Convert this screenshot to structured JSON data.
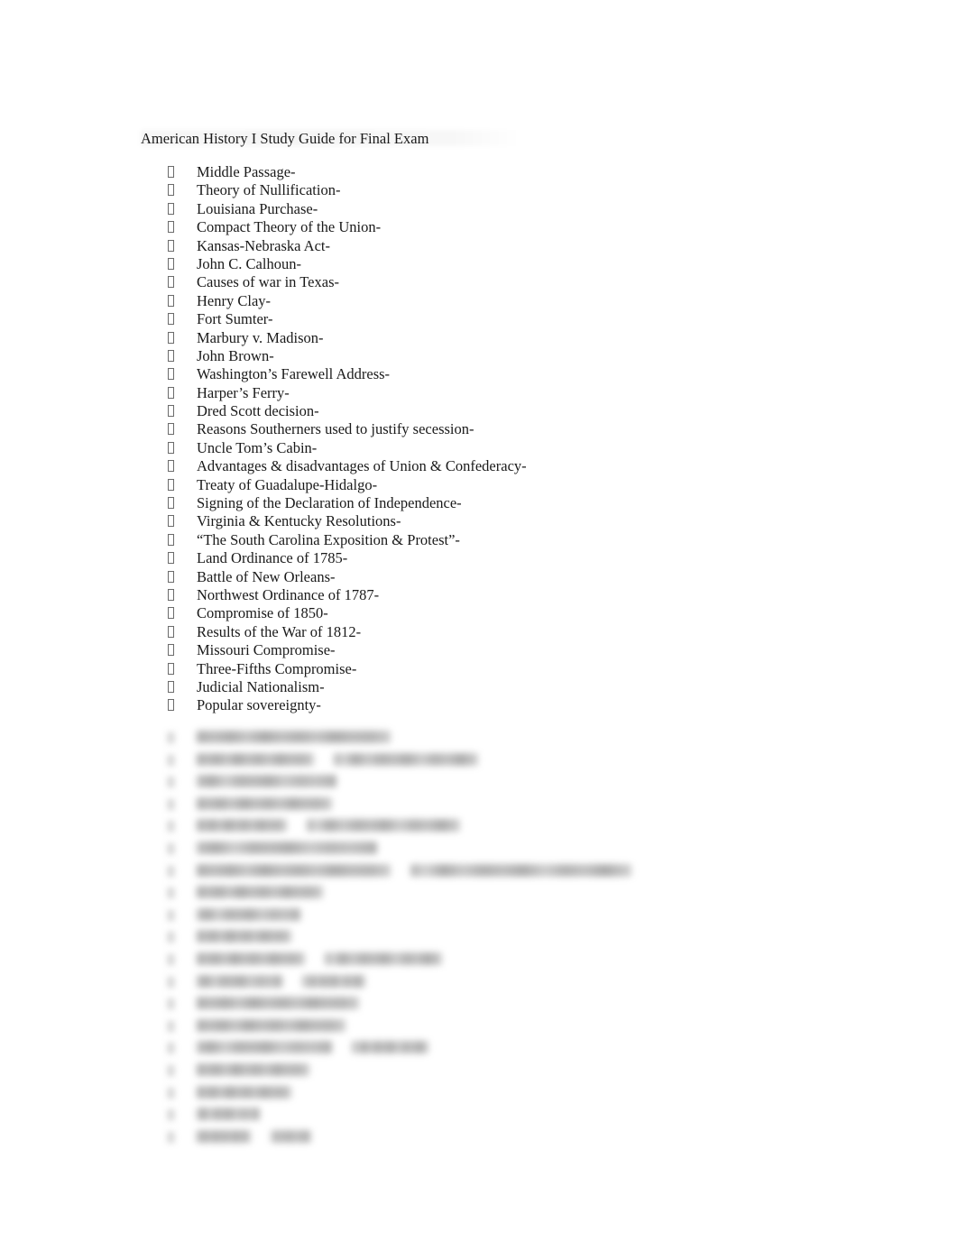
{
  "document": {
    "title": "American History I Study Guide for Final Exam",
    "title_highlight_color": "#eeeeee",
    "background_color": "#ffffff",
    "text_color": "#1a1a1a",
    "bullet_glyph": "missing-glyph-box"
  },
  "study_items": [
    {
      "text": "Middle Passage-"
    },
    {
      "text": "Theory of Nullification-"
    },
    {
      "text": "Louisiana Purchase-"
    },
    {
      "text": "Compact Theory of the Union-"
    },
    {
      "text": "Kansas-Nebraska Act-"
    },
    {
      "text": "John C. Calhoun-"
    },
    {
      "text": "Causes of war in Texas-"
    },
    {
      "text": "Henry Clay-"
    },
    {
      "text": "Fort Sumter-"
    },
    {
      "text": "Marbury v. Madison-"
    },
    {
      "text": "John Brown-"
    },
    {
      "text": "Washington’s Farewell Address-"
    },
    {
      "text": "Harper’s Ferry-"
    },
    {
      "text": "Dred Scott decision-"
    },
    {
      "text": "Reasons Southerners used to justify secession-"
    },
    {
      "text": "Uncle Tom’s Cabin-"
    },
    {
      "text": "Advantages & disadvantages of Union & Confederacy-"
    },
    {
      "text": "Treaty of Guadalupe-Hidalgo-"
    },
    {
      "text": "Signing of the Declaration of Independence-"
    },
    {
      "text": "Virginia & Kentucky Resolutions-"
    },
    {
      "text": "“The South Carolina Exposition & Protest”-"
    },
    {
      "text": "Land Ordinance of 1785-"
    },
    {
      "text": "Battle of New Orleans-"
    },
    {
      "text": "Northwest Ordinance of 1787-"
    },
    {
      "text": "Compromise of 1850-"
    },
    {
      "text": "Results of the War of 1812-"
    },
    {
      "text": "Missouri Compromise-"
    },
    {
      "text": "Three-Fifths Compromise-"
    },
    {
      "text": "Judicial Nationalism-"
    },
    {
      "text": "Popular sovereignty-"
    }
  ],
  "obscured_section": {
    "note": "blurred-illegible",
    "rows": [
      {
        "widths": [
          215
        ]
      },
      {
        "widths": [
          130,
          160
        ]
      },
      {
        "widths": [
          155
        ]
      },
      {
        "widths": [
          150
        ]
      },
      {
        "widths": [
          100,
          170
        ]
      },
      {
        "widths": [
          200
        ]
      },
      {
        "widths": [
          215,
          245
        ]
      },
      {
        "widths": [
          140
        ]
      },
      {
        "widths": [
          115
        ]
      },
      {
        "widths": [
          105
        ]
      },
      {
        "widths": [
          120,
          130
        ]
      },
      {
        "widths": [
          95,
          70
        ]
      },
      {
        "widths": [
          180
        ]
      },
      {
        "widths": [
          165
        ]
      },
      {
        "widths": [
          150,
          85
        ]
      },
      {
        "widths": [
          125
        ]
      },
      {
        "widths": [
          105
        ]
      },
      {
        "widths": [
          70
        ]
      },
      {
        "widths": [
          60,
          45
        ]
      }
    ]
  }
}
